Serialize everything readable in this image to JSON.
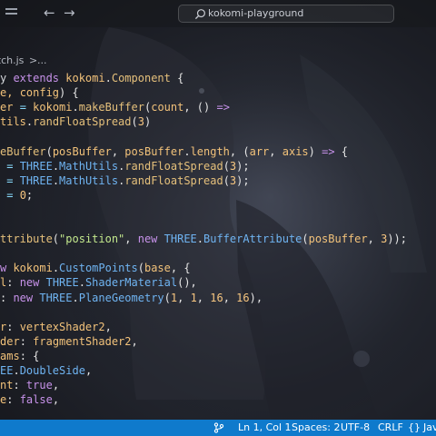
{
  "titlebar": {
    "back_glyph": "←",
    "forward_glyph": "→",
    "search_icon": "search-icon",
    "command_center_label": "kokomi-playground"
  },
  "breadcrumb": {
    "file": "etch.js",
    "separator": ">",
    "more": "..."
  },
  "code": {
    "lines": [
      [
        {
          "t": "y ",
          "c": "tk-plain"
        },
        {
          "t": "extends ",
          "c": "tk-kw"
        },
        {
          "t": "kokomi",
          "c": "tk-var"
        },
        {
          "t": ".",
          "c": "tk-pun"
        },
        {
          "t": "Component",
          "c": "tk-fn"
        },
        {
          "t": " {",
          "c": "tk-pun"
        }
      ],
      [
        {
          "t": "e, ",
          "c": "tk-var"
        },
        {
          "t": "config",
          "c": "tk-var"
        },
        {
          "t": ") {",
          "c": "tk-pun"
        }
      ],
      [
        {
          "t": "er ",
          "c": "tk-var"
        },
        {
          "t": "= ",
          "c": "tk-op"
        },
        {
          "t": "kokomi",
          "c": "tk-var"
        },
        {
          "t": ".",
          "c": "tk-pun"
        },
        {
          "t": "makeBuffer",
          "c": "tk-fn"
        },
        {
          "t": "(",
          "c": "tk-pun"
        },
        {
          "t": "count",
          "c": "tk-var"
        },
        {
          "t": ", () ",
          "c": "tk-pun"
        },
        {
          "t": "=>",
          "c": "tk-kw"
        }
      ],
      [
        {
          "t": "tils",
          "c": "tk-var"
        },
        {
          "t": ".",
          "c": "tk-pun"
        },
        {
          "t": "randFloatSpread",
          "c": "tk-fn"
        },
        {
          "t": "(",
          "c": "tk-pun"
        },
        {
          "t": "3",
          "c": "tk-num"
        },
        {
          "t": ")",
          "c": "tk-pun"
        }
      ],
      [],
      [
        {
          "t": "eBuffer",
          "c": "tk-fn"
        },
        {
          "t": "(",
          "c": "tk-pun"
        },
        {
          "t": "posBuffer",
          "c": "tk-var"
        },
        {
          "t": ", ",
          "c": "tk-pun"
        },
        {
          "t": "posBuffer",
          "c": "tk-var"
        },
        {
          "t": ".",
          "c": "tk-pun"
        },
        {
          "t": "length",
          "c": "tk-var"
        },
        {
          "t": ", (",
          "c": "tk-pun"
        },
        {
          "t": "arr",
          "c": "tk-var"
        },
        {
          "t": ", ",
          "c": "tk-pun"
        },
        {
          "t": "axis",
          "c": "tk-var"
        },
        {
          "t": ") ",
          "c": "tk-pun"
        },
        {
          "t": "=>",
          "c": "tk-kw"
        },
        {
          "t": " {",
          "c": "tk-pun"
        }
      ],
      [
        {
          "t": " = ",
          "c": "tk-op"
        },
        {
          "t": "THREE",
          "c": "tk-cls"
        },
        {
          "t": ".",
          "c": "tk-pun"
        },
        {
          "t": "MathUtils",
          "c": "tk-cls"
        },
        {
          "t": ".",
          "c": "tk-pun"
        },
        {
          "t": "randFloatSpread",
          "c": "tk-fn"
        },
        {
          "t": "(",
          "c": "tk-pun"
        },
        {
          "t": "3",
          "c": "tk-num"
        },
        {
          "t": ");",
          "c": "tk-pun"
        }
      ],
      [
        {
          "t": " = ",
          "c": "tk-op"
        },
        {
          "t": "THREE",
          "c": "tk-cls"
        },
        {
          "t": ".",
          "c": "tk-pun"
        },
        {
          "t": "MathUtils",
          "c": "tk-cls"
        },
        {
          "t": ".",
          "c": "tk-pun"
        },
        {
          "t": "randFloatSpread",
          "c": "tk-fn"
        },
        {
          "t": "(",
          "c": "tk-pun"
        },
        {
          "t": "3",
          "c": "tk-num"
        },
        {
          "t": ");",
          "c": "tk-pun"
        }
      ],
      [
        {
          "t": " = ",
          "c": "tk-op"
        },
        {
          "t": "0",
          "c": "tk-num"
        },
        {
          "t": ";",
          "c": "tk-pun"
        }
      ],
      [],
      [],
      [
        {
          "t": "ttribute",
          "c": "tk-fn"
        },
        {
          "t": "(",
          "c": "tk-pun"
        },
        {
          "t": "\"position\"",
          "c": "tk-str"
        },
        {
          "t": ", ",
          "c": "tk-pun"
        },
        {
          "t": "new ",
          "c": "tk-kw"
        },
        {
          "t": "THREE",
          "c": "tk-cls"
        },
        {
          "t": ".",
          "c": "tk-pun"
        },
        {
          "t": "BufferAttribute",
          "c": "tk-cls"
        },
        {
          "t": "(",
          "c": "tk-pun"
        },
        {
          "t": "posBuffer",
          "c": "tk-var"
        },
        {
          "t": ", ",
          "c": "tk-pun"
        },
        {
          "t": "3",
          "c": "tk-num"
        },
        {
          "t": "));",
          "c": "tk-pun"
        }
      ],
      [],
      [
        {
          "t": "w ",
          "c": "tk-kw"
        },
        {
          "t": "kokomi",
          "c": "tk-var"
        },
        {
          "t": ".",
          "c": "tk-pun"
        },
        {
          "t": "CustomPoints",
          "c": "tk-cls"
        },
        {
          "t": "(",
          "c": "tk-pun"
        },
        {
          "t": "base",
          "c": "tk-var"
        },
        {
          "t": ", {",
          "c": "tk-pun"
        }
      ],
      [
        {
          "t": "l",
          "c": "tk-var"
        },
        {
          "t": ": ",
          "c": "tk-pun"
        },
        {
          "t": "new ",
          "c": "tk-kw"
        },
        {
          "t": "THREE",
          "c": "tk-cls"
        },
        {
          "t": ".",
          "c": "tk-pun"
        },
        {
          "t": "ShaderMaterial",
          "c": "tk-cls"
        },
        {
          "t": "(),",
          "c": "tk-pun"
        }
      ],
      [
        {
          "t": ": ",
          "c": "tk-pun"
        },
        {
          "t": "new ",
          "c": "tk-kw"
        },
        {
          "t": "THREE",
          "c": "tk-cls"
        },
        {
          "t": ".",
          "c": "tk-pun"
        },
        {
          "t": "PlaneGeometry",
          "c": "tk-cls"
        },
        {
          "t": "(",
          "c": "tk-pun"
        },
        {
          "t": "1",
          "c": "tk-num"
        },
        {
          "t": ", ",
          "c": "tk-pun"
        },
        {
          "t": "1",
          "c": "tk-num"
        },
        {
          "t": ", ",
          "c": "tk-pun"
        },
        {
          "t": "16",
          "c": "tk-num"
        },
        {
          "t": ", ",
          "c": "tk-pun"
        },
        {
          "t": "16",
          "c": "tk-num"
        },
        {
          "t": "),",
          "c": "tk-pun"
        }
      ],
      [],
      [
        {
          "t": "r",
          "c": "tk-var"
        },
        {
          "t": ": ",
          "c": "tk-pun"
        },
        {
          "t": "vertexShader2",
          "c": "tk-var"
        },
        {
          "t": ",",
          "c": "tk-pun"
        }
      ],
      [
        {
          "t": "der",
          "c": "tk-var"
        },
        {
          "t": ": ",
          "c": "tk-pun"
        },
        {
          "t": "fragmentShader2",
          "c": "tk-var"
        },
        {
          "t": ",",
          "c": "tk-pun"
        }
      ],
      [
        {
          "t": "ams",
          "c": "tk-var"
        },
        {
          "t": ": {",
          "c": "tk-pun"
        }
      ],
      [
        {
          "t": "EE",
          "c": "tk-cls"
        },
        {
          "t": ".",
          "c": "tk-pun"
        },
        {
          "t": "DoubleSide",
          "c": "tk-cls"
        },
        {
          "t": ",",
          "c": "tk-pun"
        }
      ],
      [
        {
          "t": "nt",
          "c": "tk-var"
        },
        {
          "t": ": ",
          "c": "tk-pun"
        },
        {
          "t": "true",
          "c": "tk-kw"
        },
        {
          "t": ",",
          "c": "tk-pun"
        }
      ],
      [
        {
          "t": "e",
          "c": "tk-var"
        },
        {
          "t": ": ",
          "c": "tk-pun"
        },
        {
          "t": "false",
          "c": "tk-kw"
        },
        {
          "t": ",",
          "c": "tk-pun"
        }
      ]
    ]
  },
  "statusbar": {
    "branch_icon": "source-control-icon",
    "position": "Ln 1, Col 1",
    "spaces": "Spaces: 2",
    "encoding": "UTF-8",
    "eol": "CRLF",
    "braces": "{}",
    "language": "Jav",
    "bg_color": "#0f7acc"
  }
}
